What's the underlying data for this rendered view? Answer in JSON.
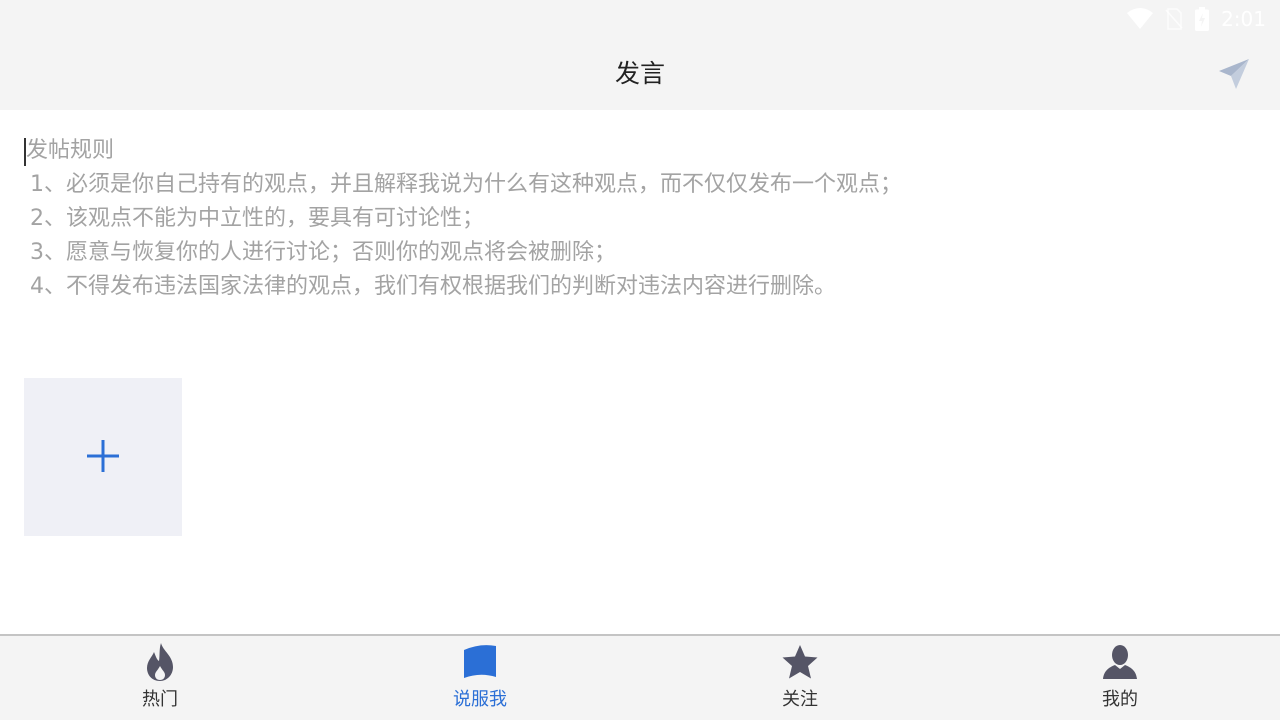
{
  "status_bar": {
    "time": "2:01",
    "icons": [
      "wifi-icon",
      "no-sim-icon",
      "battery-charging-icon"
    ]
  },
  "header": {
    "title": "发言",
    "send_icon": "send-icon"
  },
  "editor": {
    "placeholder_title": "发帖规则",
    "rules": [
      "1、必须是你自己持有的观点，并且解释我说为什么有这种观点，而不仅仅发布一个观点；",
      "2、该观点不能为中立性的，要具有可讨论性；",
      "3、愿意与恢复你的人进行讨论；否则你的观点将会被删除；",
      "4、不得发布违法国家法律的观点，我们有权根据我们的判断对违法内容进行删除。"
    ]
  },
  "add_image": {
    "icon": "plus-icon"
  },
  "bottom_nav": {
    "items": [
      {
        "label": "热门",
        "icon": "flame-icon",
        "active": false
      },
      {
        "label": "说服我",
        "icon": "flag-icon",
        "active": true
      },
      {
        "label": "关注",
        "icon": "star-icon",
        "active": false
      },
      {
        "label": "我的",
        "icon": "person-icon",
        "active": false
      }
    ]
  },
  "colors": {
    "accent": "#2b6fd6",
    "placeholder_text": "#a3a3a3",
    "bar_background": "#f4f4f4",
    "add_tile_background": "#eff0f6",
    "inactive_icon": "#555566"
  }
}
